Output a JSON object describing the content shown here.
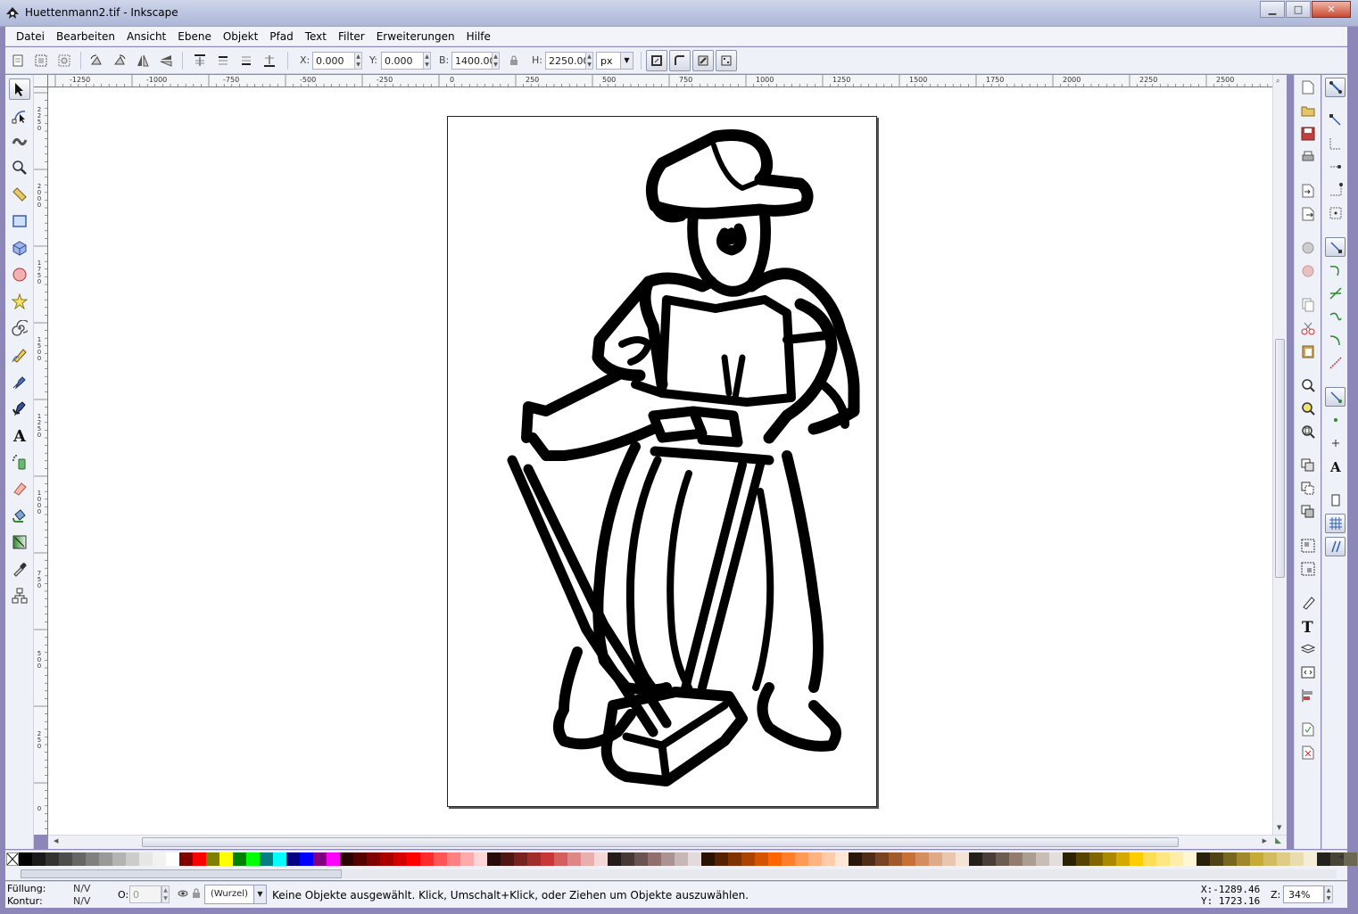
{
  "window": {
    "title": "Huettenmann2.tif - Inkscape",
    "buttons": {
      "minimize": "▁",
      "maximize": "□",
      "close": "✕"
    }
  },
  "menu": [
    {
      "name": "menu-datei",
      "label": "Datei"
    },
    {
      "name": "menu-bearbeiten",
      "label": "Bearbeiten"
    },
    {
      "name": "menu-ansicht",
      "label": "Ansicht"
    },
    {
      "name": "menu-ebene",
      "label": "Ebene"
    },
    {
      "name": "menu-objekt",
      "label": "Objekt"
    },
    {
      "name": "menu-pfad",
      "label": "Pfad"
    },
    {
      "name": "menu-text",
      "label": "Text"
    },
    {
      "name": "menu-filter",
      "label": "Filter"
    },
    {
      "name": "menu-erweiterungen",
      "label": "Erweiterungen"
    },
    {
      "name": "menu-hilfe",
      "label": "Hilfe"
    }
  ],
  "tool_controls": {
    "x_label": "X:",
    "x_value": "0.000",
    "y_label": "Y:",
    "y_value": "0.000",
    "w_label": "B:",
    "w_value": "1400.00",
    "h_label": "H:",
    "h_value": "2250.00",
    "unit": "px"
  },
  "ruler": {
    "top_labels": [
      "-1250",
      "-1000",
      "-750",
      "-500",
      "-250",
      "0",
      "250",
      "500",
      "750",
      "1000",
      "1250",
      "1500",
      "1750",
      "2000",
      "2250",
      "2500"
    ],
    "left_labels": [
      "2250",
      "2000",
      "1750",
      "1500",
      "1250",
      "1000",
      "750",
      "500",
      "250",
      "0"
    ]
  },
  "palette": {
    "colors": [
      "#000000",
      "#1a1a1a",
      "#333333",
      "#4d4d4d",
      "#666666",
      "#808080",
      "#999999",
      "#b3b3b3",
      "#cccccc",
      "#e6e6e6",
      "#f2f2f2",
      "#ffffff",
      "#800000",
      "#ff0000",
      "#808000",
      "#ffff00",
      "#008000",
      "#00ff00",
      "#008080",
      "#00ffff",
      "#000080",
      "#0000ff",
      "#800080",
      "#ff00ff",
      "#2b0000",
      "#550000",
      "#800000",
      "#aa0000",
      "#d40000",
      "#ff0000",
      "#ff2a2a",
      "#ff5555",
      "#ff8080",
      "#ffaaaa",
      "#ffd5d5",
      "#280b0b",
      "#501616",
      "#782121",
      "#a02c2c",
      "#c83737",
      "#d35f5f",
      "#de8787",
      "#e9afaf",
      "#f4d7d7",
      "#241c1c",
      "#483737",
      "#6c5353",
      "#916f6f",
      "#ac9393",
      "#c8b7b7",
      "#e3dbdb",
      "#2b1100",
      "#552200",
      "#803300",
      "#aa4400",
      "#d45500",
      "#ff6600",
      "#ff7f2a",
      "#ff9955",
      "#ffb380",
      "#ffccaa",
      "#ffe6d5",
      "#28170b",
      "#502d16",
      "#784421",
      "#a05a2c",
      "#c87137",
      "#d38d5f",
      "#deaa87",
      "#e9c6af",
      "#f4e3d7",
      "#241f1c",
      "#483e37",
      "#6c5d53",
      "#917c6f",
      "#ac9d93",
      "#c8beb7",
      "#e3dedb",
      "#2b2200",
      "#554400",
      "#806600",
      "#aa8800",
      "#d4aa00",
      "#ffcc00",
      "#ffdd55",
      "#ffe680",
      "#ffeeaa",
      "#fff6d5",
      "#28220b",
      "#504416",
      "#786721",
      "#a0892c",
      "#c8ab37",
      "#d3bc5f",
      "#decd87",
      "#e9ddaf",
      "#f4eed7",
      "#24221c",
      "#484537",
      "#6c6753",
      "#918a6f",
      "#aca793",
      "#c8c4b7",
      "#e3e2db"
    ]
  },
  "status": {
    "fill_label": "Füllung:",
    "fill_value": "N/V",
    "stroke_label": "Kontur:",
    "stroke_value": "N/V",
    "opacity_label": "O:",
    "opacity_value": "0",
    "layer": "(Wurzel)",
    "message": "Keine Objekte ausgewählt. Klick, Umschalt+Klick, oder Ziehen um Objekte auszuwählen.",
    "x_readout": "X:-1289.46",
    "y_readout": "Y: 1723.16",
    "zoom_label": "Z:",
    "zoom_value": "34%"
  }
}
